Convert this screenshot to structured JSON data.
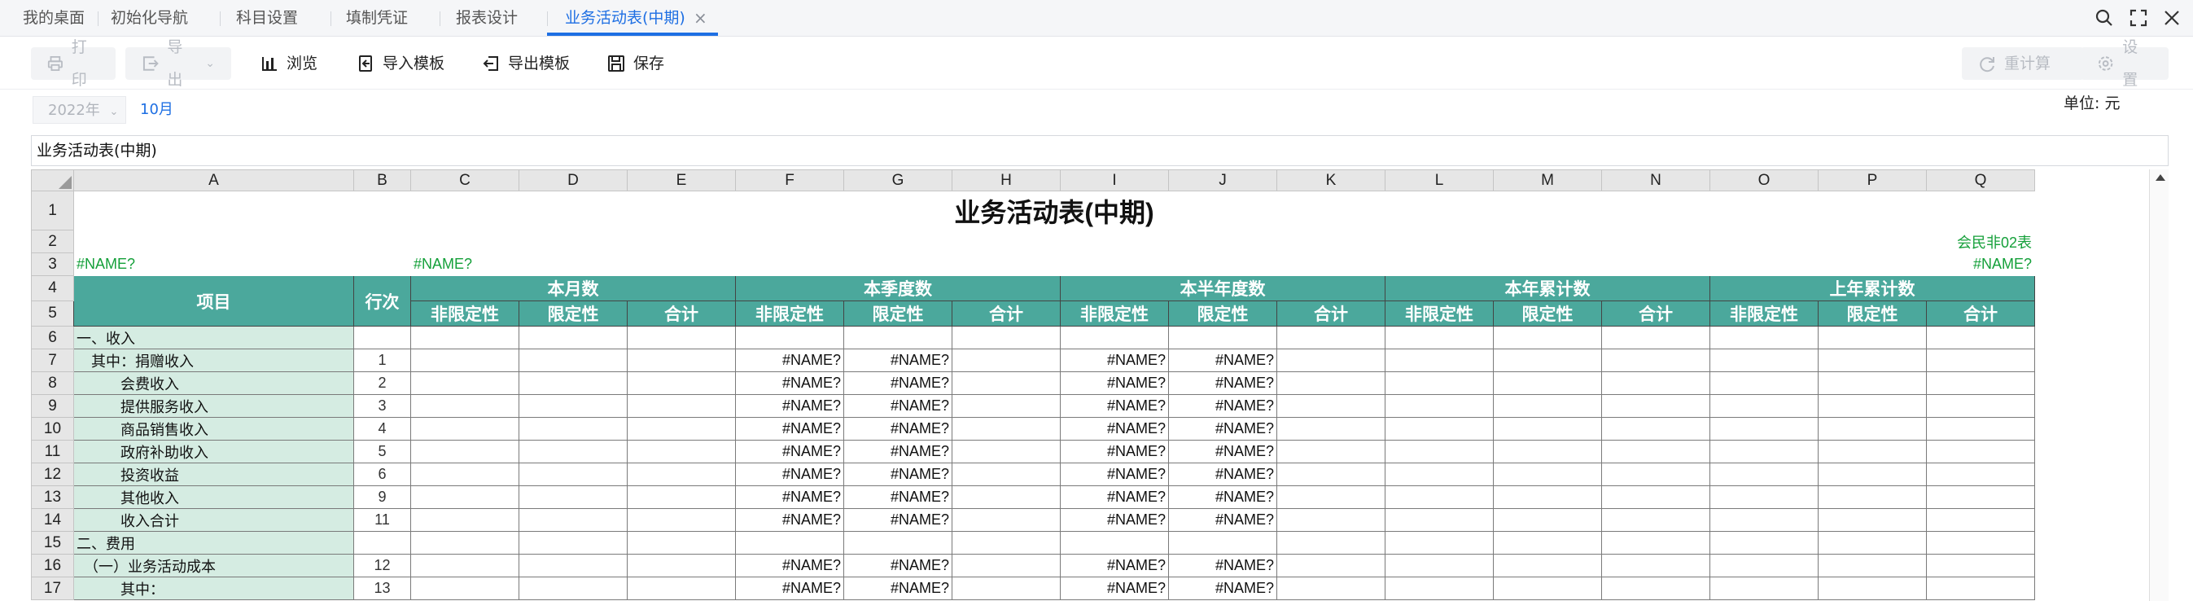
{
  "tabs": [
    {
      "label": "我的桌面"
    },
    {
      "label": "初始化导航"
    },
    {
      "label": "科目设置"
    },
    {
      "label": "填制凭证"
    },
    {
      "label": "报表设计"
    },
    {
      "label": "业务活动表(中期)"
    }
  ],
  "tab_close": "×",
  "window_icons": [
    "search-icon",
    "expand-icon",
    "close-icon"
  ],
  "toolbar": {
    "print": "打印",
    "export": "导出",
    "browse": "浏览",
    "import_template": "导入模板",
    "export_template": "导出模板",
    "save": "保存",
    "recalc": "重计算",
    "settings": "设置"
  },
  "period": {
    "year": "2022年",
    "month": "10月"
  },
  "unit": "单位: 元",
  "formula_bar": "业务活动表(中期)",
  "sheet": {
    "columns": [
      "A",
      "B",
      "C",
      "D",
      "E",
      "F",
      "G",
      "H",
      "I",
      "J",
      "K",
      "L",
      "M",
      "N",
      "O",
      "P",
      "Q"
    ],
    "row_numbers": [
      "1",
      "2",
      "3",
      "4",
      "5",
      "6",
      "7",
      "8",
      "9",
      "10",
      "11",
      "12",
      "13",
      "14",
      "15",
      "16",
      "17"
    ],
    "title": "业务活动表(中期)",
    "form_code": "会民非02表",
    "name_a3": "#NAME?",
    "name_c3": "#NAME?",
    "name_q3": "#NAME?",
    "col_item": "项目",
    "col_line": "行次",
    "groups": [
      "本月数",
      "本季度数",
      "本半年度数",
      "本年累计数",
      "上年累计数"
    ],
    "sub_headers": [
      "非限定性",
      "限定性",
      "合计"
    ],
    "error_value": "#NAME?",
    "rows": [
      {
        "item": "一、收入",
        "line": "",
        "vals": false
      },
      {
        "item": "　其中：捐赠收入",
        "line": "1",
        "vals": true
      },
      {
        "item": "　　　会费收入",
        "line": "2",
        "vals": true
      },
      {
        "item": "　　　提供服务收入",
        "line": "3",
        "vals": true
      },
      {
        "item": "　　　商品销售收入",
        "line": "4",
        "vals": true
      },
      {
        "item": "　　　政府补助收入",
        "line": "5",
        "vals": true
      },
      {
        "item": "　　　投资收益",
        "line": "6",
        "vals": true
      },
      {
        "item": "　　　其他收入",
        "line": "9",
        "vals": true
      },
      {
        "item": "　　　收入合计",
        "line": "11",
        "vals": true
      },
      {
        "item": "二、费用",
        "line": "",
        "vals": false
      },
      {
        "item": "　（一）业务活动成本",
        "line": "12",
        "vals": true
      },
      {
        "item": "　　　其中：",
        "line": "13",
        "vals": true
      }
    ]
  },
  "colors": {
    "accent": "#1e6fe3",
    "header_teal": "#4ba89c",
    "item_green": "#d5ece2",
    "form_text": "#15a03a"
  }
}
